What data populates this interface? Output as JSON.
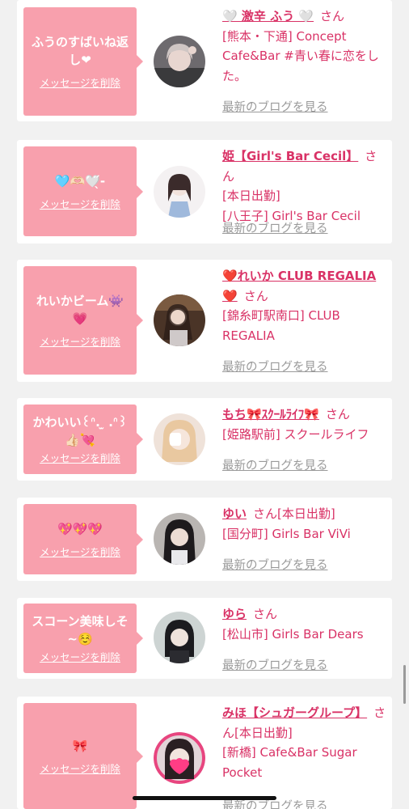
{
  "common": {
    "delete_label": "メッセージを削除",
    "blog_label": "最新のブログを見る",
    "san": "さん"
  },
  "cards": [
    {
      "message": "ふうのすばいね返し❤",
      "name": "🤍 激辛 ふう 🤍",
      "status": "",
      "shop": "[熊本・下通] Concept Cafe&Bar #青い春に恋をした。"
    },
    {
      "message": "🩵🫶🏻🤍̖́-",
      "name": "姫【Girl's Bar Cecil】",
      "status": "[本日出勤]",
      "shop": "[八王子] Girl's Bar Cecil"
    },
    {
      "message": "れいかビーム👾💗",
      "name": "❤️れいか CLUB REGALIA❤️",
      "status": "",
      "shop": "[錦糸町駅南口] CLUB REGALIA"
    },
    {
      "message": "かわいい꒰ᐢ. ̫ .ᐢ꒱👍🏻💘",
      "name": "もち🎀ｽｸｰﾙﾗｲﾌ🎀",
      "status": "",
      "shop": "[姫路駅前] スクールライフ"
    },
    {
      "message": "💖💖💖",
      "name": "ゆい",
      "status": "[本日出勤]",
      "shop": "[国分町] Girls Bar ViVi"
    },
    {
      "message": "スコーン美味しそ~☺️",
      "name": "ゆら",
      "status": "",
      "shop": "[松山市] Girls Bar Dears"
    },
    {
      "message": "🎀",
      "name": "みほ【シュガーグループ】",
      "status": "[本日出勤]",
      "shop": "[新橋] Cafe&Bar Sugar Pocket"
    }
  ],
  "colors": {
    "accent": "#d93266",
    "message_bg": "#f8a0ad",
    "link_gray": "#9a9a9a"
  },
  "icons": {
    "avatar": "avatar-photo"
  }
}
